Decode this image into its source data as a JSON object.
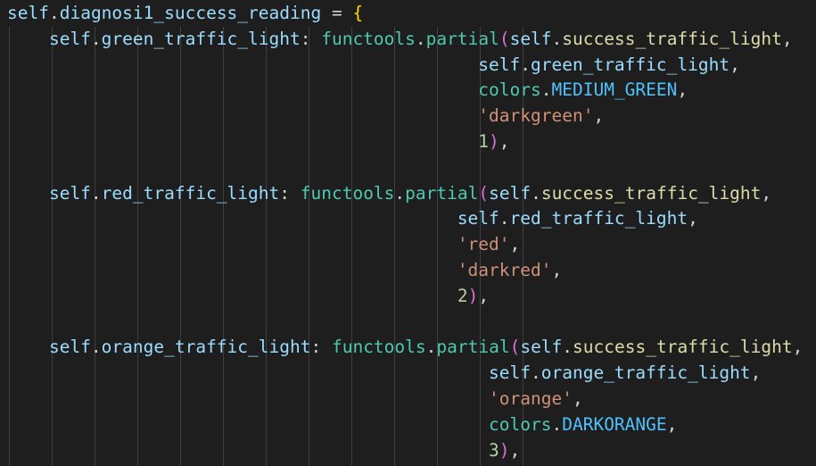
{
  "colors": {
    "background": "#1e1e1e",
    "variable": "#9cdcfe",
    "punctuation": "#d4d4d4",
    "module": "#4ec9b0",
    "function": "#dcdcaa",
    "string": "#ce9178",
    "number": "#b5cea8",
    "brace": "#ffd700",
    "paren": "#da70d6",
    "constant": "#4fc1ff"
  },
  "code_lines": [
    {
      "tokens": [
        {
          "t": "self",
          "c": "var"
        },
        {
          "t": ".",
          "c": "punc"
        },
        {
          "t": "diagnosi1_success_reading",
          "c": "var"
        },
        {
          "t": " = ",
          "c": "punc"
        },
        {
          "t": "{",
          "c": "brace"
        }
      ]
    },
    {
      "tokens": [
        {
          "t": "    self",
          "c": "var"
        },
        {
          "t": ".",
          "c": "punc"
        },
        {
          "t": "green_traffic_light",
          "c": "var"
        },
        {
          "t": ": ",
          "c": "punc"
        },
        {
          "t": "functools",
          "c": "fn"
        },
        {
          "t": ".",
          "c": "punc"
        },
        {
          "t": "partial",
          "c": "fn"
        },
        {
          "t": "(",
          "c": "paren"
        },
        {
          "t": "self",
          "c": "var"
        },
        {
          "t": ".",
          "c": "punc"
        },
        {
          "t": "success_traffic_light",
          "c": "method"
        },
        {
          "t": ",",
          "c": "punc"
        }
      ]
    },
    {
      "tokens": [
        {
          "t": "                                             self",
          "c": "var"
        },
        {
          "t": ".",
          "c": "punc"
        },
        {
          "t": "green_traffic_light",
          "c": "var"
        },
        {
          "t": ",",
          "c": "punc"
        }
      ]
    },
    {
      "tokens": [
        {
          "t": "                                             colors",
          "c": "fn"
        },
        {
          "t": ".",
          "c": "punc"
        },
        {
          "t": "MEDIUM_GREEN",
          "c": "const"
        },
        {
          "t": ",",
          "c": "punc"
        }
      ]
    },
    {
      "tokens": [
        {
          "t": "                                             'darkgreen'",
          "c": "str"
        },
        {
          "t": ",",
          "c": "punc"
        }
      ]
    },
    {
      "tokens": [
        {
          "t": "                                             1",
          "c": "num"
        },
        {
          "t": ")",
          "c": "paren"
        },
        {
          "t": ",",
          "c": "punc"
        }
      ]
    },
    {
      "tokens": []
    },
    {
      "tokens": [
        {
          "t": "    self",
          "c": "var"
        },
        {
          "t": ".",
          "c": "punc"
        },
        {
          "t": "red_traffic_light",
          "c": "var"
        },
        {
          "t": ": ",
          "c": "punc"
        },
        {
          "t": "functools",
          "c": "fn"
        },
        {
          "t": ".",
          "c": "punc"
        },
        {
          "t": "partial",
          "c": "fn"
        },
        {
          "t": "(",
          "c": "paren"
        },
        {
          "t": "self",
          "c": "var"
        },
        {
          "t": ".",
          "c": "punc"
        },
        {
          "t": "success_traffic_light",
          "c": "method"
        },
        {
          "t": ",",
          "c": "punc"
        }
      ]
    },
    {
      "tokens": [
        {
          "t": "                                           self",
          "c": "var"
        },
        {
          "t": ".",
          "c": "punc"
        },
        {
          "t": "red_traffic_light",
          "c": "var"
        },
        {
          "t": ",",
          "c": "punc"
        }
      ]
    },
    {
      "tokens": [
        {
          "t": "                                           'red'",
          "c": "str"
        },
        {
          "t": ",",
          "c": "punc"
        }
      ]
    },
    {
      "tokens": [
        {
          "t": "                                           'darkred'",
          "c": "str"
        },
        {
          "t": ",",
          "c": "punc"
        }
      ]
    },
    {
      "tokens": [
        {
          "t": "                                           2",
          "c": "num"
        },
        {
          "t": ")",
          "c": "paren"
        },
        {
          "t": ",",
          "c": "punc"
        }
      ]
    },
    {
      "tokens": []
    },
    {
      "tokens": [
        {
          "t": "    self",
          "c": "var"
        },
        {
          "t": ".",
          "c": "punc"
        },
        {
          "t": "orange_traffic_light",
          "c": "var"
        },
        {
          "t": ": ",
          "c": "punc"
        },
        {
          "t": "functools",
          "c": "fn"
        },
        {
          "t": ".",
          "c": "punc"
        },
        {
          "t": "partial",
          "c": "fn"
        },
        {
          "t": "(",
          "c": "paren"
        },
        {
          "t": "self",
          "c": "var"
        },
        {
          "t": ".",
          "c": "punc"
        },
        {
          "t": "success_traffic_light",
          "c": "method"
        },
        {
          "t": ",",
          "c": "punc"
        }
      ]
    },
    {
      "tokens": [
        {
          "t": "                                              self",
          "c": "var"
        },
        {
          "t": ".",
          "c": "punc"
        },
        {
          "t": "orange_traffic_light",
          "c": "var"
        },
        {
          "t": ",",
          "c": "punc"
        }
      ]
    },
    {
      "tokens": [
        {
          "t": "                                              'orange'",
          "c": "str"
        },
        {
          "t": ",",
          "c": "punc"
        }
      ]
    },
    {
      "tokens": [
        {
          "t": "                                              colors",
          "c": "fn"
        },
        {
          "t": ".",
          "c": "punc"
        },
        {
          "t": "DARKORANGE",
          "c": "const"
        },
        {
          "t": ",",
          "c": "punc"
        }
      ]
    },
    {
      "tokens": [
        {
          "t": "                                              3",
          "c": "num"
        },
        {
          "t": ")",
          "c": "paren"
        },
        {
          "t": ",",
          "c": "punc"
        }
      ]
    }
  ]
}
